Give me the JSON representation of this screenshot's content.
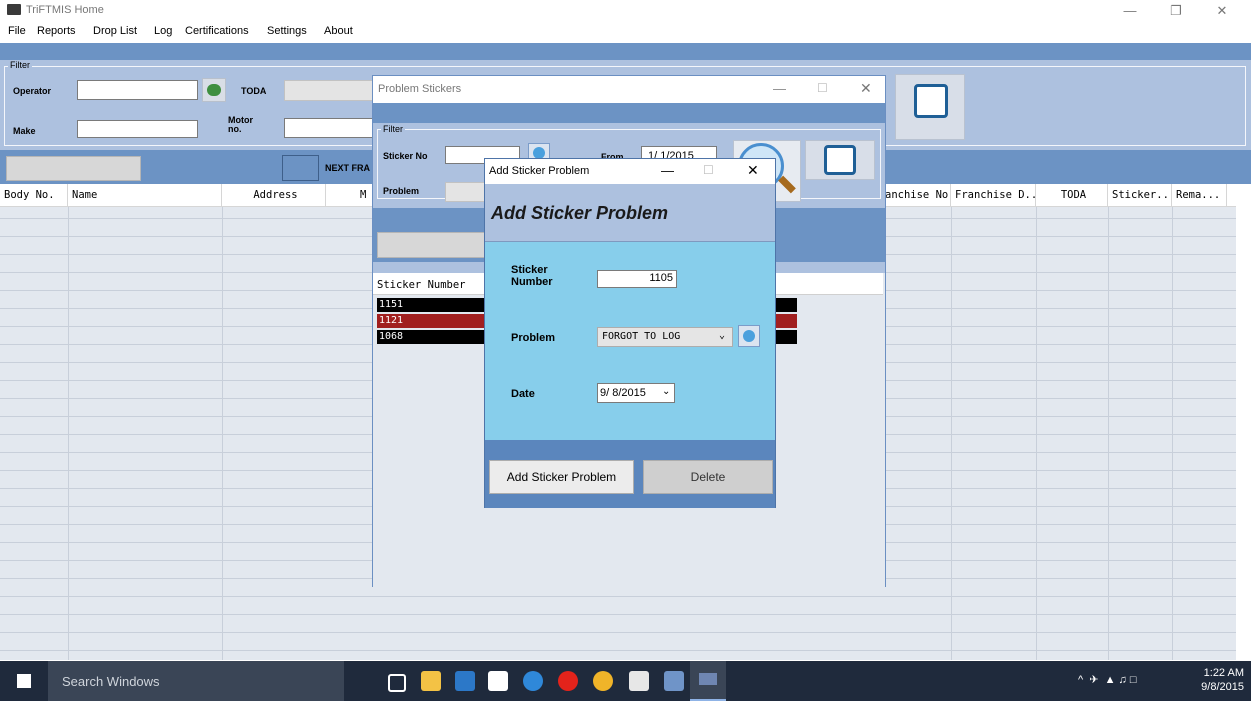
{
  "app": {
    "title": "TriFTMIS Home"
  },
  "menu": [
    "File",
    "Reports",
    "Drop List",
    "Log",
    "Certifications",
    "Settings",
    "About"
  ],
  "filter": {
    "group_label": "Filter",
    "operator_label": "Operator",
    "toda_label": "TODA",
    "make_label": "Make",
    "motor_label_1": "Motor",
    "motor_label_2": "no."
  },
  "next_label": "NEXT FRA",
  "grid": {
    "columns": [
      "Body No.",
      "Name",
      "Address",
      "M",
      "anchise No.",
      "Franchise D...",
      "TODA",
      "Sticker...",
      "Rema..."
    ]
  },
  "problem_window": {
    "title": "Problem Stickers",
    "filter_label": "Filter",
    "sticker_no_label": "Sticker No",
    "from_label": "From",
    "from_date": "1/ 1/2015",
    "problem_label": "Problem",
    "list_header": "Sticker Number",
    "stickers": [
      {
        "number": "1151",
        "color": "#000000"
      },
      {
        "number": "1121",
        "color": "#a11f1f"
      },
      {
        "number": "1068",
        "color": "#000000"
      }
    ]
  },
  "add_dialog": {
    "title": "Add Sticker Problem",
    "heading": "Add Sticker Problem",
    "sticker_label_1": "Sticker",
    "sticker_label_2": "Number",
    "sticker_value": "1105",
    "problem_label": "Problem",
    "problem_value": "FORGOT TO LOG",
    "date_label": "Date",
    "date_value": "9/ 8/2015",
    "add_button": "Add Sticker Problem",
    "delete_button": "Delete"
  },
  "taskbar": {
    "search": "Search Windows",
    "time": "1:22 AM",
    "date": "9/8/2015"
  },
  "colors": {
    "accent": "#6c93c4",
    "panel": "#adc1df",
    "dialog_body": "#87ceeb"
  }
}
